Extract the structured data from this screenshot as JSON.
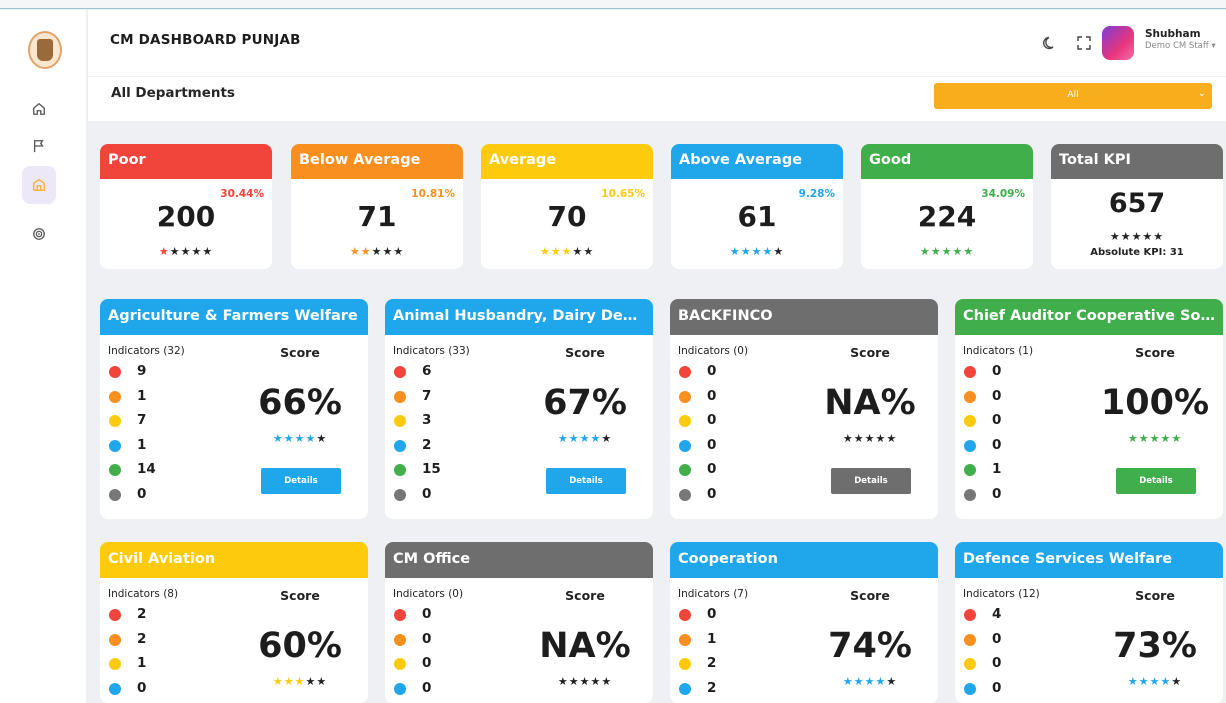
{
  "app": {
    "title": "CM DASHBOARD PUNJAB",
    "user": {
      "name": "Shubham",
      "role": "Demo CM Staff ▾"
    }
  },
  "sidebar": {
    "items": [
      {
        "icon": "home-icon"
      },
      {
        "icon": "flag-icon"
      },
      {
        "icon": "building-icon"
      },
      {
        "icon": "target-icon"
      }
    ]
  },
  "filter": {
    "title": "All Departments",
    "select_value": "All",
    "select_color": "#f7ad1c"
  },
  "categories": [
    {
      "label": "Poor",
      "percent": "30.44%",
      "count": "200",
      "stars": 1,
      "color": "#f1443a"
    },
    {
      "label": "Below Average",
      "percent": "10.81%",
      "count": "71",
      "stars": 2,
      "color": "#f88f1e"
    },
    {
      "label": "Average",
      "percent": "10.65%",
      "count": "70",
      "stars": 3,
      "color": "#fdcb0c"
    },
    {
      "label": "Above Average",
      "percent": "9.28%",
      "count": "61",
      "stars": 4,
      "color": "#20a6eb"
    },
    {
      "label": "Good",
      "percent": "34.09%",
      "count": "224",
      "stars": 5,
      "color": "#3fae4b"
    }
  ],
  "total_kpi": {
    "label": "Total KPI",
    "count": "657",
    "stars": "★★★★★",
    "absolute": "Absolute KPI: 31",
    "color": "#6e6e6e"
  },
  "indicator_colors": [
    "#f1443a",
    "#f88f1e",
    "#fdcb0c",
    "#20a6eb",
    "#3fae4b",
    "#777777"
  ],
  "departments": [
    {
      "name": "Agriculture & Farmers Welfare",
      "indicators": "Indicators (32)",
      "score_label": "Score",
      "score": "66%",
      "stars": 4,
      "color": "#20a6eb",
      "counts": [
        "9",
        "1",
        "7",
        "1",
        "14",
        "0"
      ],
      "button": "Details"
    },
    {
      "name": "Animal Husbandry, Dairy Development",
      "indicators": "Indicators (33)",
      "score_label": "Score",
      "score": "67%",
      "stars": 4,
      "color": "#20a6eb",
      "counts": [
        "6",
        "7",
        "3",
        "2",
        "15",
        "0"
      ],
      "button": "Details"
    },
    {
      "name": "BACKFINCO",
      "indicators": "Indicators (0)",
      "score_label": "Score",
      "score": "NA%",
      "stars": 0,
      "color": "#6e6e6e",
      "counts": [
        "0",
        "0",
        "0",
        "0",
        "0",
        "0"
      ],
      "button": "Details"
    },
    {
      "name": "Chief Auditor Cooperative Societies",
      "indicators": "Indicators (1)",
      "score_label": "Score",
      "score": "100%",
      "stars": 5,
      "color": "#3fae4b",
      "counts": [
        "0",
        "0",
        "0",
        "0",
        "1",
        "0"
      ],
      "button": "Details"
    },
    {
      "name": "Civil Aviation",
      "indicators": "Indicators (8)",
      "score_label": "Score",
      "score": "60%",
      "stars": 3,
      "color": "#fdcb0c",
      "counts": [
        "2",
        "2",
        "1",
        "0"
      ],
      "button": ""
    },
    {
      "name": "CM Office",
      "indicators": "Indicators (0)",
      "score_label": "Score",
      "score": "NA%",
      "stars": 0,
      "color": "#6e6e6e",
      "counts": [
        "0",
        "0",
        "0",
        "0"
      ],
      "button": ""
    },
    {
      "name": "Cooperation",
      "indicators": "Indicators (7)",
      "score_label": "Score",
      "score": "74%",
      "stars": 4,
      "color": "#20a6eb",
      "counts": [
        "0",
        "1",
        "2",
        "2"
      ],
      "button": ""
    },
    {
      "name": "Defence Services Welfare",
      "indicators": "Indicators (12)",
      "score_label": "Score",
      "score": "73%",
      "stars": 4,
      "color": "#20a6eb",
      "counts": [
        "4",
        "0",
        "0",
        "0"
      ],
      "button": ""
    }
  ]
}
